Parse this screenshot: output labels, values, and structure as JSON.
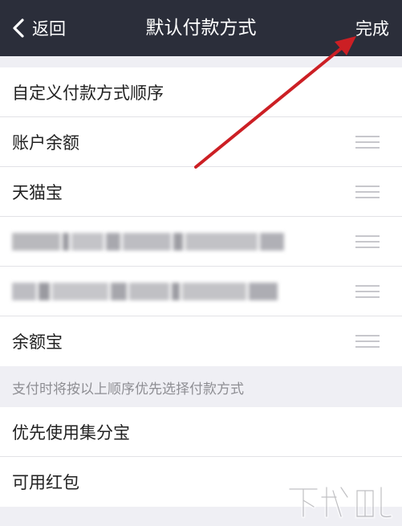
{
  "nav": {
    "back_label": "返回",
    "title": "默认付款方式",
    "done_label": "完成",
    "background": "#2b2e3a"
  },
  "order_section": {
    "header_label": "自定义付款方式顺序",
    "items": [
      {
        "label": "账户余额"
      },
      {
        "label": "天猫宝"
      },
      {
        "label": ""
      },
      {
        "label": ""
      },
      {
        "label": "余额宝"
      }
    ]
  },
  "footnote": "支付时将按以上顺序优先选择付款方式",
  "options_section": {
    "items": [
      {
        "label": "优先使用集分宝"
      },
      {
        "label": "可用红包"
      }
    ]
  },
  "annotation": {
    "arrow_color": "#cc1f24"
  },
  "watermark": {
    "text": "下载吧"
  }
}
